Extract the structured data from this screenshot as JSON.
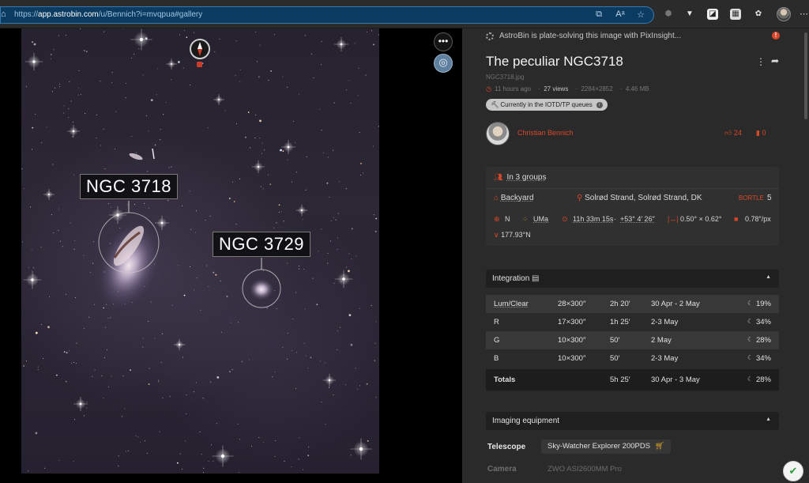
{
  "browser": {
    "url_prefix": "https://",
    "url_host": "app.astrobin.com",
    "url_path": "/u/Bennich?i=mvqpua#gallery"
  },
  "image": {
    "labels": [
      "NGC 3718",
      "NGC 3729"
    ]
  },
  "panel": {
    "status_text": "AstroBin is plate-solving this image with PixInsight...",
    "title": "The peculiar NGC3718",
    "filename": "NGC3718.jpg",
    "posted": "11 hours ago",
    "views": "27 views",
    "dimensions": "2284×2852",
    "filesize": "4.46 MB",
    "iotd_badge": "Currently in the IOTD/TP queues",
    "author": "Christian Bennich",
    "likes": "24",
    "bookmarks": "0",
    "groups": "In 3 groups",
    "location_name": "Backyard",
    "location_place": "Solrød Strand, Solrød Strand, DK",
    "bortle_label": "BORTLE",
    "bortle_value": "5",
    "orientation": "N",
    "constellation": "UMa",
    "ra": "11h 33m 15s",
    "dec": "+53° 4′ 26″",
    "field_size": "0.50° × 0.62°",
    "pixel_scale": "0.78″/px",
    "rotation": "177.93°N",
    "integration_header": "Integration",
    "integration_rows": [
      {
        "filter": "Lum/Clear",
        "frames": "28×300″",
        "time": "2h 20′",
        "dates": "30 Apr - 2 May",
        "moon": "19%"
      },
      {
        "filter": "R",
        "frames": "17×300″",
        "time": "1h 25′",
        "dates": "2-3 May",
        "moon": "34%"
      },
      {
        "filter": "G",
        "frames": "10×300″",
        "time": "50′",
        "dates": "2 May",
        "moon": "28%"
      },
      {
        "filter": "B",
        "frames": "10×300″",
        "time": "50′",
        "dates": "2-3 May",
        "moon": "34%"
      }
    ],
    "totals": {
      "label": "Totals",
      "time": "5h 25′",
      "dates": "30 Apr - 3 May",
      "moon": "28%"
    },
    "equipment_header": "Imaging equipment",
    "telescope_label": "Telescope",
    "telescope_value": "Sky-Watcher Explorer 200PDS",
    "camera_label": "Camera",
    "camera_value": "ZWO ASI2600MM Pro"
  },
  "colors": {
    "accent": "#d8472a",
    "panel_bg": "#2a2a2a",
    "url_bar": "#0b3b60"
  }
}
